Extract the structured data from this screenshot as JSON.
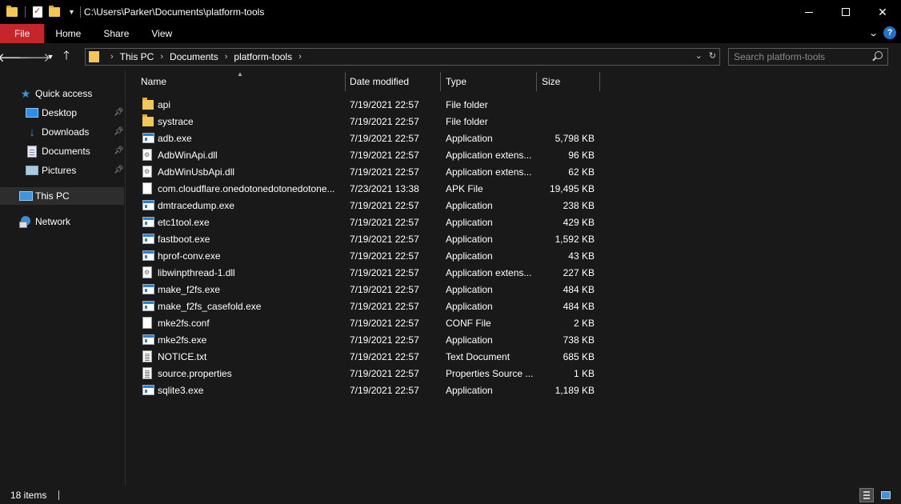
{
  "window": {
    "title_path": "C:\\Users\\Parker\\Documents\\platform-tools",
    "close_glyph": "✕"
  },
  "ribbon": {
    "tabs": [
      "File",
      "Home",
      "Share",
      "View"
    ],
    "help_glyph": "?"
  },
  "address_bar": {
    "crumbs": [
      "This PC",
      "Documents",
      "platform-tools"
    ]
  },
  "search": {
    "placeholder": "Search platform-tools"
  },
  "sidebar": {
    "items": [
      {
        "label": "Quick access",
        "icon": "star-icon"
      },
      {
        "label": "Desktop",
        "icon": "desktop-icon",
        "pinned": true
      },
      {
        "label": "Downloads",
        "icon": "download-icon",
        "pinned": true
      },
      {
        "label": "Documents",
        "icon": "documents-icon",
        "pinned": true
      },
      {
        "label": "Pictures",
        "icon": "pictures-icon",
        "pinned": true
      },
      {
        "label": "This PC",
        "icon": "computer-icon",
        "selected": true
      },
      {
        "label": "Network",
        "icon": "network-icon"
      }
    ]
  },
  "columns": {
    "name": "Name",
    "date": "Date modified",
    "type": "Type",
    "size": "Size"
  },
  "files": [
    {
      "name": "api",
      "date": "7/19/2021 22:57",
      "type": "File folder",
      "size": "",
      "icon": "folder"
    },
    {
      "name": "systrace",
      "date": "7/19/2021 22:57",
      "type": "File folder",
      "size": "",
      "icon": "folder"
    },
    {
      "name": "adb.exe",
      "date": "7/19/2021 22:57",
      "type": "Application",
      "size": "5,798 KB",
      "icon": "exe"
    },
    {
      "name": "AdbWinApi.dll",
      "date": "7/19/2021 22:57",
      "type": "Application extens...",
      "size": "96 KB",
      "icon": "dll"
    },
    {
      "name": "AdbWinUsbApi.dll",
      "date": "7/19/2021 22:57",
      "type": "Application extens...",
      "size": "62 KB",
      "icon": "dll"
    },
    {
      "name": "com.cloudflare.onedotonedotonedotone...",
      "date": "7/23/2021 13:38",
      "type": "APK File",
      "size": "19,495 KB",
      "icon": "file"
    },
    {
      "name": "dmtracedump.exe",
      "date": "7/19/2021 22:57",
      "type": "Application",
      "size": "238 KB",
      "icon": "exe"
    },
    {
      "name": "etc1tool.exe",
      "date": "7/19/2021 22:57",
      "type": "Application",
      "size": "429 KB",
      "icon": "exe"
    },
    {
      "name": "fastboot.exe",
      "date": "7/19/2021 22:57",
      "type": "Application",
      "size": "1,592 KB",
      "icon": "exe"
    },
    {
      "name": "hprof-conv.exe",
      "date": "7/19/2021 22:57",
      "type": "Application",
      "size": "43 KB",
      "icon": "exe"
    },
    {
      "name": "libwinpthread-1.dll",
      "date": "7/19/2021 22:57",
      "type": "Application extens...",
      "size": "227 KB",
      "icon": "dll"
    },
    {
      "name": "make_f2fs.exe",
      "date": "7/19/2021 22:57",
      "type": "Application",
      "size": "484 KB",
      "icon": "exe"
    },
    {
      "name": "make_f2fs_casefold.exe",
      "date": "7/19/2021 22:57",
      "type": "Application",
      "size": "484 KB",
      "icon": "exe"
    },
    {
      "name": "mke2fs.conf",
      "date": "7/19/2021 22:57",
      "type": "CONF File",
      "size": "2 KB",
      "icon": "file"
    },
    {
      "name": "mke2fs.exe",
      "date": "7/19/2021 22:57",
      "type": "Application",
      "size": "738 KB",
      "icon": "exe"
    },
    {
      "name": "NOTICE.txt",
      "date": "7/19/2021 22:57",
      "type": "Text Document",
      "size": "685 KB",
      "icon": "txt"
    },
    {
      "name": "source.properties",
      "date": "7/19/2021 22:57",
      "type": "Properties Source ...",
      "size": "1 KB",
      "icon": "txt"
    },
    {
      "name": "sqlite3.exe",
      "date": "7/19/2021 22:57",
      "type": "Application",
      "size": "1,189 KB",
      "icon": "exe"
    }
  ],
  "status": {
    "item_count": "18 items"
  }
}
